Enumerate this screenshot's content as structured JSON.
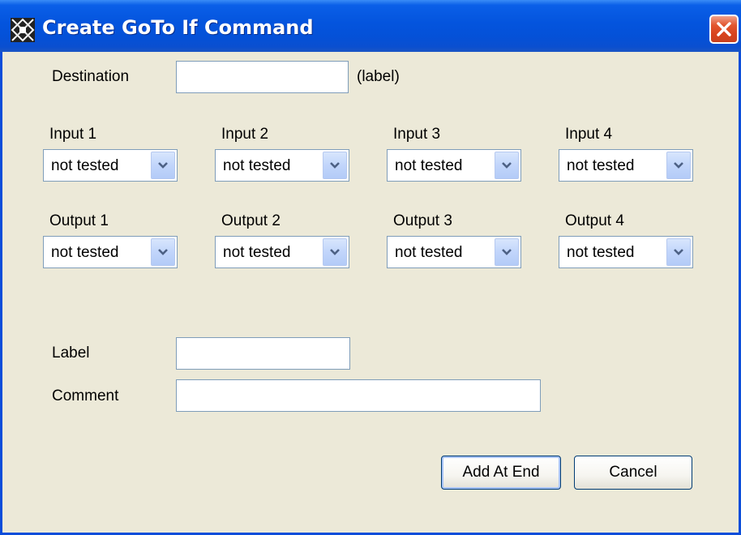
{
  "window": {
    "title": "Create GoTo If Command",
    "app_icon": "pattern-icon",
    "close_icon": "close-icon",
    "colors": {
      "title_bar": "#0454dd",
      "close_button": "#d8431c",
      "dialog_background": "#ece9d8",
      "field_border": "#7f9db9"
    }
  },
  "destination": {
    "label": "Destination",
    "value": "",
    "hint": "(label)"
  },
  "inputs": [
    {
      "label": "Input 1",
      "value": "not tested"
    },
    {
      "label": "Input 2",
      "value": "not tested"
    },
    {
      "label": "Input 3",
      "value": "not tested"
    },
    {
      "label": "Input 4",
      "value": "not tested"
    }
  ],
  "outputs": [
    {
      "label": "Output 1",
      "value": "not tested"
    },
    {
      "label": "Output 2",
      "value": "not tested"
    },
    {
      "label": "Output 3",
      "value": "not tested"
    },
    {
      "label": "Output 4",
      "value": "not tested"
    }
  ],
  "label_field": {
    "label": "Label",
    "value": ""
  },
  "comment_field": {
    "label": "Comment",
    "value": ""
  },
  "buttons": {
    "add_at_end": "Add At End",
    "cancel": "Cancel"
  }
}
